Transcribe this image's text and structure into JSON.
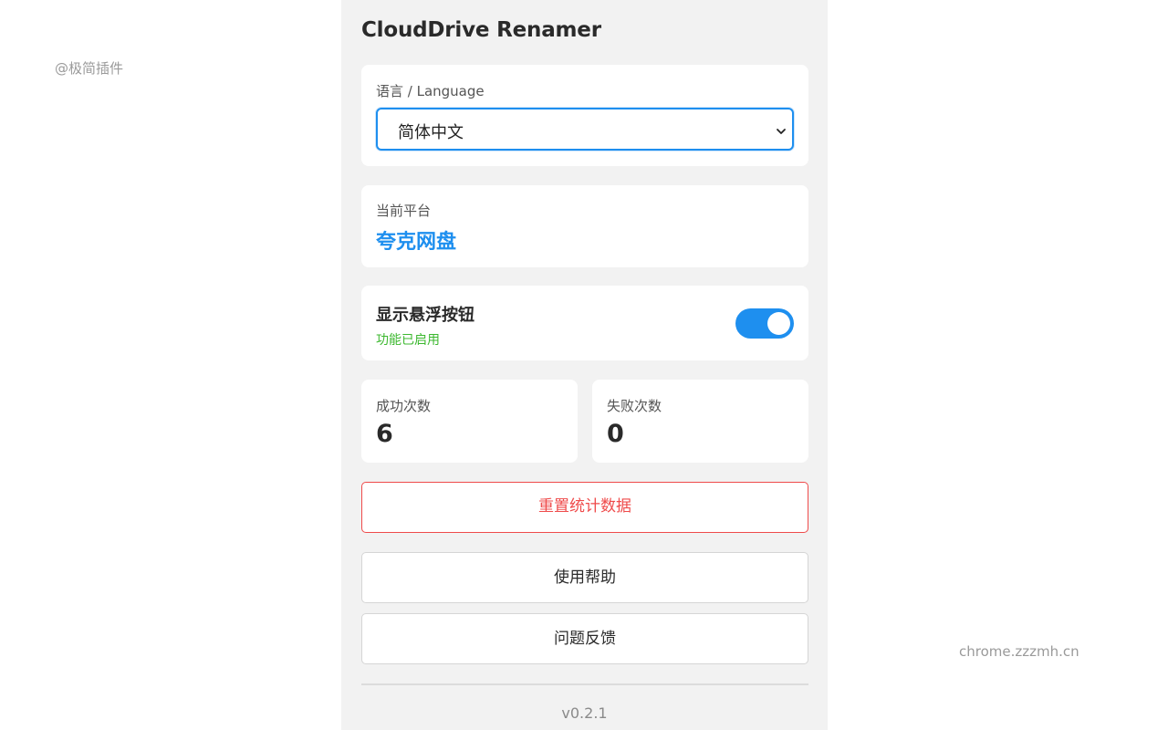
{
  "watermarks": {
    "left": "@极简插件",
    "right": "chrome.zzzmh.cn"
  },
  "app": {
    "title": "CloudDrive Renamer",
    "version": "v0.2.1"
  },
  "language": {
    "label": "语言 / Language",
    "selected": "简体中文"
  },
  "platform": {
    "label": "当前平台",
    "value": "夸克网盘"
  },
  "float_button": {
    "title": "显示悬浮按钮",
    "status": "功能已启用",
    "enabled": true
  },
  "stats": {
    "success_label": "成功次数",
    "success_value": "6",
    "fail_label": "失败次数",
    "fail_value": "0"
  },
  "buttons": {
    "reset": "重置统计数据",
    "help": "使用帮助",
    "feedback": "问题反馈"
  },
  "colors": {
    "accent": "#1e8fef",
    "success": "#3cb82f",
    "danger": "#ef4b4b",
    "panel_bg": "#f2f2f2"
  }
}
